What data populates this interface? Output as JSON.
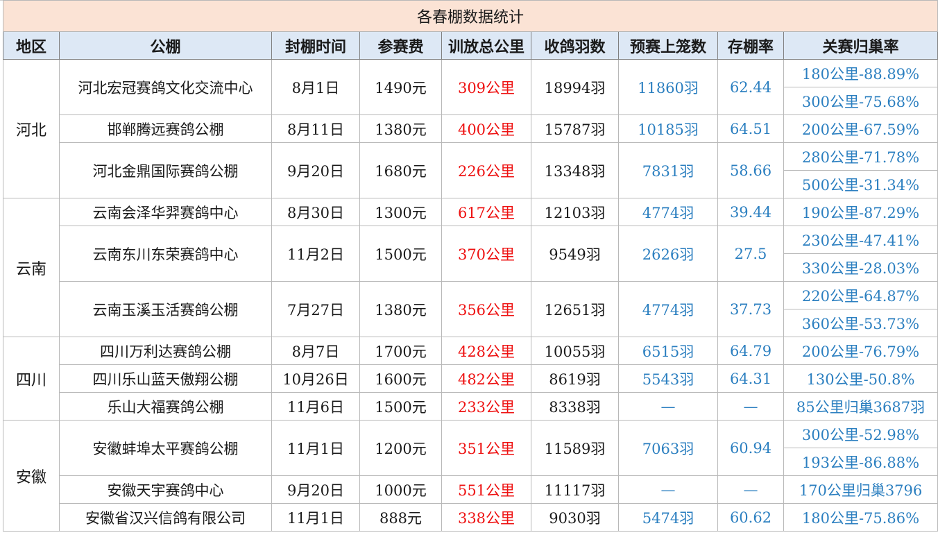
{
  "title": "各春棚数据统计",
  "headers": [
    "地区",
    "公棚",
    "封棚时间",
    "参赛费",
    "训放总公里",
    "收鸽羽数",
    "预赛上笼数",
    "存棚率",
    "关赛归巢率"
  ],
  "regions": [
    {
      "name": "河北",
      "lofts": [
        {
          "name": "河北宏冠赛鸽文化交流中心",
          "date": "8月1日",
          "fee": "1490元",
          "km": "309公里",
          "birds": "18994羽",
          "prelim": "11860羽",
          "rate": "62.44",
          "returns": [
            "180公里-88.89%",
            "300公里-75.68%"
          ]
        },
        {
          "name": "邯郸腾远赛鸽公棚",
          "date": "8月11日",
          "fee": "1380元",
          "km": "400公里",
          "birds": "15787羽",
          "prelim": "10185羽",
          "rate": "64.51",
          "returns": [
            "200公里-67.59%"
          ]
        },
        {
          "name": "河北金鼎国际赛鸽公棚",
          "date": "9月20日",
          "fee": "1680元",
          "km": "226公里",
          "birds": "13348羽",
          "prelim": "7831羽",
          "rate": "58.66",
          "returns": [
            "280公里-71.78%",
            "500公里-31.34%"
          ]
        }
      ]
    },
    {
      "name": "云南",
      "lofts": [
        {
          "name": "云南会泽华羿赛鸽中心",
          "date": "8月30日",
          "fee": "1300元",
          "km": "617公里",
          "birds": "12103羽",
          "prelim": "4774羽",
          "rate": "39.44",
          "returns": [
            "190公里-87.29%"
          ]
        },
        {
          "name": "云南东川东荣赛鸽中心",
          "date": "11月2日",
          "fee": "1500元",
          "km": "370公里",
          "birds": "9549羽",
          "prelim": "2626羽",
          "rate": "27.5",
          "returns": [
            "230公里-47.41%",
            "330公里-28.03%"
          ]
        },
        {
          "name": "云南玉溪玉活赛鸽公棚",
          "date": "7月27日",
          "fee": "1380元",
          "km": "356公里",
          "birds": "12651羽",
          "prelim": "4774羽",
          "rate": "37.73",
          "returns": [
            "220公里-64.87%",
            "360公里-53.73%"
          ]
        }
      ]
    },
    {
      "name": "四川",
      "lofts": [
        {
          "name": "四川万利达赛鸽公棚",
          "date": "8月7日",
          "fee": "1700元",
          "km": "428公里",
          "birds": "10055羽",
          "prelim": "6515羽",
          "rate": "64.79",
          "returns": [
            "200公里-76.79%"
          ]
        },
        {
          "name": "四川乐山蓝天傲翔公棚",
          "date": "10月26日",
          "fee": "1600元",
          "km": "482公里",
          "birds": "8619羽",
          "prelim": "5543羽",
          "rate": "64.31",
          "returns": [
            "130公里-50.8%"
          ]
        },
        {
          "name": "乐山大福赛鸽公棚",
          "date": "11月6日",
          "fee": "1500元",
          "km": "233公里",
          "birds": "8338羽",
          "prelim": "—",
          "rate": "—",
          "returns": [
            "85公里归巢3687羽"
          ]
        }
      ]
    },
    {
      "name": "安徽",
      "lofts": [
        {
          "name": "安徽蚌埠太平赛鸽公棚",
          "date": "11月1日",
          "fee": "1200元",
          "km": "351公里",
          "birds": "11589羽",
          "prelim": "7063羽",
          "rate": "60.94",
          "returns": [
            "300公里-52.98%",
            "193公里-86.88%"
          ]
        },
        {
          "name": "安徽天宇赛鸽中心",
          "date": "9月20日",
          "fee": "1000元",
          "km": "551公里",
          "birds": "11117羽",
          "prelim": "—",
          "rate": "—",
          "returns": [
            "170公里归巢3796"
          ]
        },
        {
          "name": "安徽省汉兴信鸽有限公司",
          "date": "11月1日",
          "fee": "888元",
          "km": "338公里",
          "birds": "9030羽",
          "prelim": "5474羽",
          "rate": "60.62",
          "returns": [
            "180公里-75.86%"
          ]
        }
      ]
    }
  ]
}
